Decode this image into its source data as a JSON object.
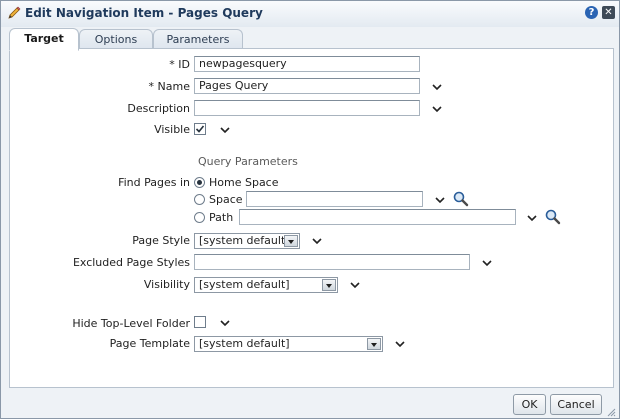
{
  "dialog": {
    "title": "Edit Navigation Item - Pages Query",
    "help_glyph": "?",
    "close_glyph": "✕"
  },
  "tabs": [
    {
      "label": "Target",
      "active": true
    },
    {
      "label": "Options",
      "active": false
    },
    {
      "label": "Parameters",
      "active": false
    }
  ],
  "form": {
    "id": {
      "label": "ID",
      "required_mark": "*",
      "value": "newpagesquery"
    },
    "name": {
      "label": "Name",
      "required_mark": "*",
      "value": "Pages Query"
    },
    "description": {
      "label": "Description",
      "value": ""
    },
    "visible": {
      "label": "Visible",
      "checked": true
    },
    "query_section": "Query Parameters",
    "find_pages": {
      "label": "Find Pages in",
      "options": [
        {
          "label": "Home Space",
          "selected": true
        },
        {
          "label": "Space",
          "selected": false,
          "value": ""
        },
        {
          "label": "Path",
          "selected": false,
          "value": ""
        }
      ]
    },
    "page_style": {
      "label": "Page Style",
      "value": "[system default]"
    },
    "excluded_page_styles": {
      "label": "Excluded Page Styles",
      "value": ""
    },
    "visibility": {
      "label": "Visibility",
      "value": "[system default]"
    },
    "hide_top_level_folder": {
      "label": "Hide Top-Level Folder",
      "checked": false
    },
    "page_template": {
      "label": "Page Template",
      "value": "[system default]"
    }
  },
  "buttons": {
    "ok": "OK",
    "cancel": "Cancel"
  },
  "colors": {
    "title_text": "#1f3a5c",
    "panel_bg": "#ffffff",
    "dialog_bg": "#eef2f6",
    "help_icon": "#2a64b3"
  }
}
